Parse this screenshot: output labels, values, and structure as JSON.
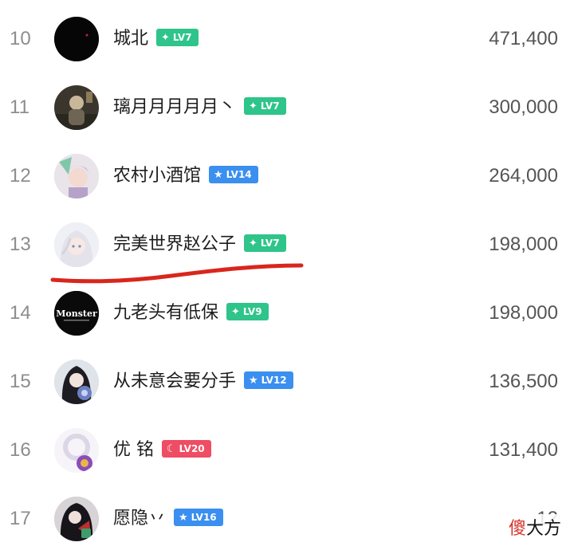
{
  "leaderboard": [
    {
      "rank": "10",
      "name": "城北",
      "badge": "LV7",
      "badge_icon": "sparkle-icon",
      "badge_color": "#2ec48a",
      "score": "471,400"
    },
    {
      "rank": "11",
      "name": "璃月月月月月丶",
      "badge": "LV7",
      "badge_icon": "sparkle-icon",
      "badge_color": "#2ec48a",
      "score": "300,000"
    },
    {
      "rank": "12",
      "name": "农村小酒馆",
      "badge": "LV14",
      "badge_icon": "star-icon",
      "badge_color": "#3a8ff0",
      "score": "264,000"
    },
    {
      "rank": "13",
      "name": "完美世界赵公子",
      "badge": "LV7",
      "badge_icon": "sparkle-icon",
      "badge_color": "#2ec48a",
      "score": "198,000"
    },
    {
      "rank": "14",
      "name": "九老头有低保",
      "badge": "LV9",
      "badge_icon": "sparkle-icon",
      "badge_color": "#2ec48a",
      "score": "198,000"
    },
    {
      "rank": "15",
      "name": "从未意会要分手",
      "badge": "LV12",
      "badge_icon": "star-icon",
      "badge_color": "#3a8ff0",
      "score": "136,500"
    },
    {
      "rank": "16",
      "name": "优 铭",
      "badge": "LV20",
      "badge_icon": "moon-icon",
      "badge_color": "#ef4d64",
      "score": "131,400"
    },
    {
      "rank": "17",
      "name": "愿隐丷",
      "badge": "LV16",
      "badge_icon": "star-icon",
      "badge_color": "#3a8ff0",
      "score": "12"
    }
  ],
  "avatar_text": {
    "monster": "Monster"
  },
  "watermark": {
    "char1": "傻",
    "rest": "大方"
  },
  "colors": {
    "highlight_stroke": "#d9261c"
  }
}
